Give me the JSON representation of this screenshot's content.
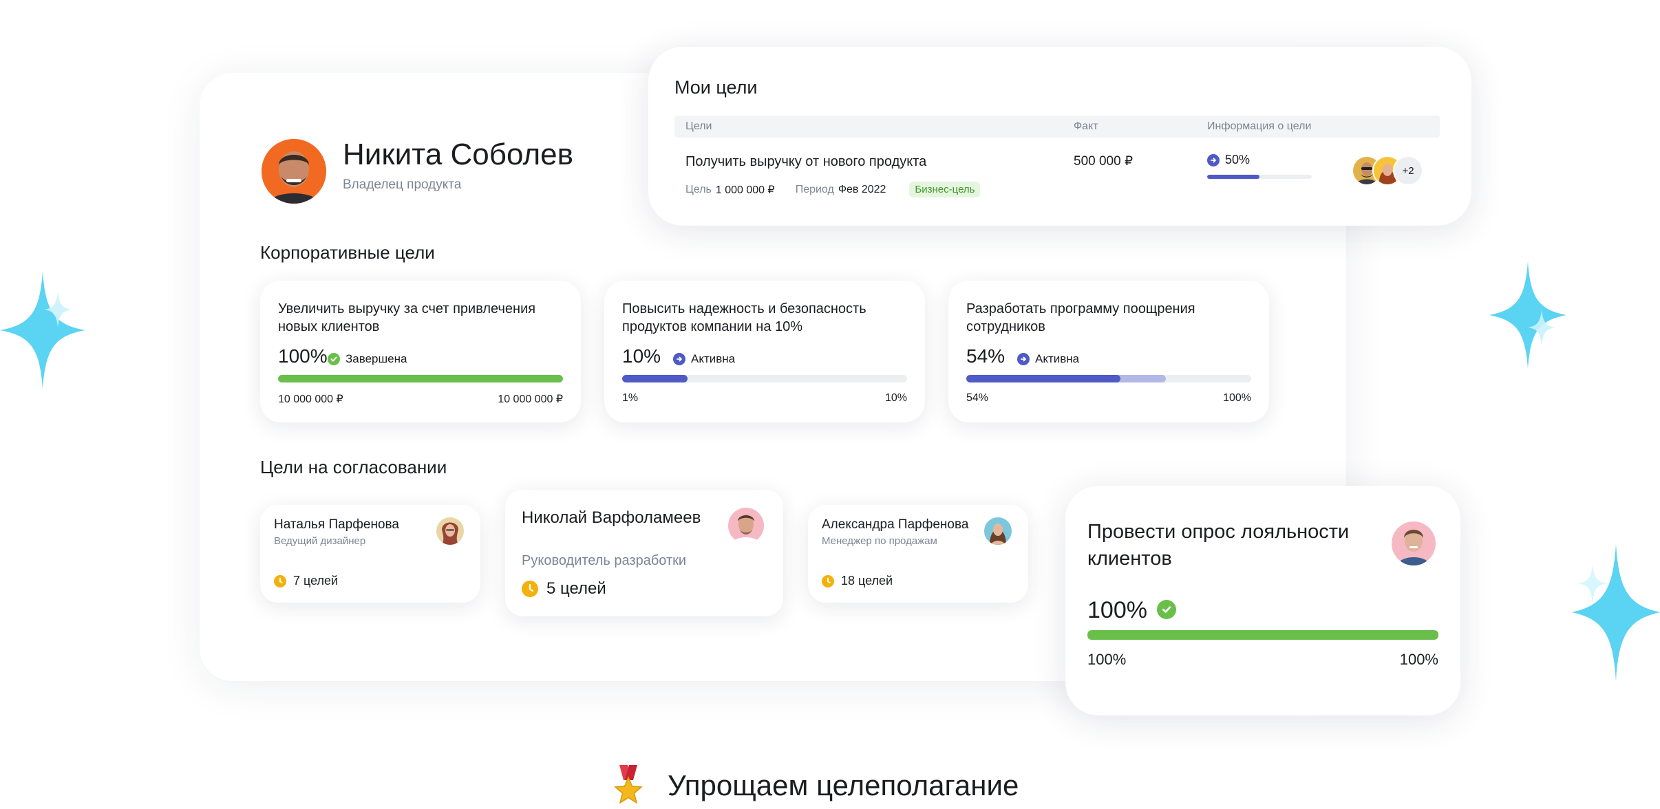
{
  "colors": {
    "green": "#6abf4b",
    "blue": "#4e5ac6",
    "blue_light": "#b3b8e6",
    "track": "#eceef2",
    "sparkle": "#5bd3f2",
    "gold": "#f2b10d",
    "badge_bg": "#e6f5e0",
    "badge_text": "#3f9a2a"
  },
  "profile": {
    "name": "Никита Соболев",
    "role": "Владелец продукта"
  },
  "my_goals": {
    "title": "Мои цели",
    "columns": [
      "Цели",
      "Факт",
      "Информация о цели"
    ],
    "row": {
      "goal": "Получить выручку от нового продукта",
      "fact": "500 000 ₽",
      "progress_label": "50%",
      "progress": 0.5,
      "target_label": "Цель",
      "target_value": "1 000 000 ₽",
      "period_label": "Период",
      "period_value": "Фев 2022",
      "badge": "Бизнес-цель",
      "extra_members": "+2"
    }
  },
  "corporate": {
    "title": "Корпоративные цели",
    "cards": [
      {
        "title": "Увеличить выручку за счет привлечения новых клиентов",
        "pct": "100%",
        "status": "Завершена",
        "status_type": "done",
        "progress": 1.0,
        "secondary": 0,
        "min": "10 000 000 ₽",
        "max": "10 000 000 ₽"
      },
      {
        "title": "Повысить надежность и безопасность продуктов компании на 10%",
        "pct": "10%",
        "status": "Активна",
        "status_type": "active",
        "progress": 0.23,
        "secondary": 0,
        "min": "1%",
        "max": "10%"
      },
      {
        "title": "Разработать программу поощрения сотрудников",
        "pct": "54%",
        "status": "Активна",
        "status_type": "active",
        "progress": 0.54,
        "secondary": 0.7,
        "min": "54%",
        "max": "100%"
      }
    ]
  },
  "approval": {
    "title": "Цели на согласовании",
    "cards": [
      {
        "name": "Наталья Парфенова",
        "role": "Ведущий дизайнер",
        "count": "7 целей"
      },
      {
        "name": "Николай Варфоламеев",
        "role": "Руководитель разработки",
        "count": "5 целей"
      },
      {
        "name": "Александра Парфенова",
        "role": "Менеджер по продажам",
        "count": "18 целей"
      }
    ]
  },
  "loyalty": {
    "title": "Провести опрос лояльности клиентов",
    "pct": "100%",
    "progress": 1.0,
    "min": "100%",
    "max": "100%"
  },
  "footer": {
    "tagline": "Упрощаем целеполагание",
    "icon": "medal-icon"
  }
}
